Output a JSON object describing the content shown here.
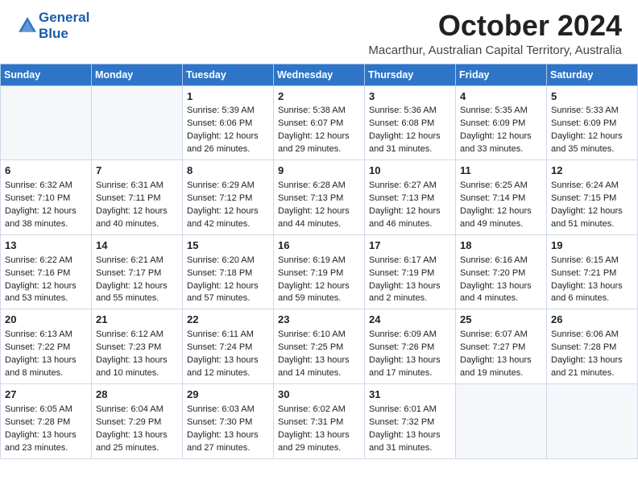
{
  "header": {
    "logo_line1": "General",
    "logo_line2": "Blue",
    "month_title": "October 2024",
    "location": "Macarthur, Australian Capital Territory, Australia"
  },
  "weekdays": [
    "Sunday",
    "Monday",
    "Tuesday",
    "Wednesday",
    "Thursday",
    "Friday",
    "Saturday"
  ],
  "weeks": [
    [
      {
        "day": "",
        "info": ""
      },
      {
        "day": "",
        "info": ""
      },
      {
        "day": "1",
        "info": "Sunrise: 5:39 AM\nSunset: 6:06 PM\nDaylight: 12 hours\nand 26 minutes."
      },
      {
        "day": "2",
        "info": "Sunrise: 5:38 AM\nSunset: 6:07 PM\nDaylight: 12 hours\nand 29 minutes."
      },
      {
        "day": "3",
        "info": "Sunrise: 5:36 AM\nSunset: 6:08 PM\nDaylight: 12 hours\nand 31 minutes."
      },
      {
        "day": "4",
        "info": "Sunrise: 5:35 AM\nSunset: 6:09 PM\nDaylight: 12 hours\nand 33 minutes."
      },
      {
        "day": "5",
        "info": "Sunrise: 5:33 AM\nSunset: 6:09 PM\nDaylight: 12 hours\nand 35 minutes."
      }
    ],
    [
      {
        "day": "6",
        "info": "Sunrise: 6:32 AM\nSunset: 7:10 PM\nDaylight: 12 hours\nand 38 minutes."
      },
      {
        "day": "7",
        "info": "Sunrise: 6:31 AM\nSunset: 7:11 PM\nDaylight: 12 hours\nand 40 minutes."
      },
      {
        "day": "8",
        "info": "Sunrise: 6:29 AM\nSunset: 7:12 PM\nDaylight: 12 hours\nand 42 minutes."
      },
      {
        "day": "9",
        "info": "Sunrise: 6:28 AM\nSunset: 7:13 PM\nDaylight: 12 hours\nand 44 minutes."
      },
      {
        "day": "10",
        "info": "Sunrise: 6:27 AM\nSunset: 7:13 PM\nDaylight: 12 hours\nand 46 minutes."
      },
      {
        "day": "11",
        "info": "Sunrise: 6:25 AM\nSunset: 7:14 PM\nDaylight: 12 hours\nand 49 minutes."
      },
      {
        "day": "12",
        "info": "Sunrise: 6:24 AM\nSunset: 7:15 PM\nDaylight: 12 hours\nand 51 minutes."
      }
    ],
    [
      {
        "day": "13",
        "info": "Sunrise: 6:22 AM\nSunset: 7:16 PM\nDaylight: 12 hours\nand 53 minutes."
      },
      {
        "day": "14",
        "info": "Sunrise: 6:21 AM\nSunset: 7:17 PM\nDaylight: 12 hours\nand 55 minutes."
      },
      {
        "day": "15",
        "info": "Sunrise: 6:20 AM\nSunset: 7:18 PM\nDaylight: 12 hours\nand 57 minutes."
      },
      {
        "day": "16",
        "info": "Sunrise: 6:19 AM\nSunset: 7:19 PM\nDaylight: 12 hours\nand 59 minutes."
      },
      {
        "day": "17",
        "info": "Sunrise: 6:17 AM\nSunset: 7:19 PM\nDaylight: 13 hours\nand 2 minutes."
      },
      {
        "day": "18",
        "info": "Sunrise: 6:16 AM\nSunset: 7:20 PM\nDaylight: 13 hours\nand 4 minutes."
      },
      {
        "day": "19",
        "info": "Sunrise: 6:15 AM\nSunset: 7:21 PM\nDaylight: 13 hours\nand 6 minutes."
      }
    ],
    [
      {
        "day": "20",
        "info": "Sunrise: 6:13 AM\nSunset: 7:22 PM\nDaylight: 13 hours\nand 8 minutes."
      },
      {
        "day": "21",
        "info": "Sunrise: 6:12 AM\nSunset: 7:23 PM\nDaylight: 13 hours\nand 10 minutes."
      },
      {
        "day": "22",
        "info": "Sunrise: 6:11 AM\nSunset: 7:24 PM\nDaylight: 13 hours\nand 12 minutes."
      },
      {
        "day": "23",
        "info": "Sunrise: 6:10 AM\nSunset: 7:25 PM\nDaylight: 13 hours\nand 14 minutes."
      },
      {
        "day": "24",
        "info": "Sunrise: 6:09 AM\nSunset: 7:26 PM\nDaylight: 13 hours\nand 17 minutes."
      },
      {
        "day": "25",
        "info": "Sunrise: 6:07 AM\nSunset: 7:27 PM\nDaylight: 13 hours\nand 19 minutes."
      },
      {
        "day": "26",
        "info": "Sunrise: 6:06 AM\nSunset: 7:28 PM\nDaylight: 13 hours\nand 21 minutes."
      }
    ],
    [
      {
        "day": "27",
        "info": "Sunrise: 6:05 AM\nSunset: 7:28 PM\nDaylight: 13 hours\nand 23 minutes."
      },
      {
        "day": "28",
        "info": "Sunrise: 6:04 AM\nSunset: 7:29 PM\nDaylight: 13 hours\nand 25 minutes."
      },
      {
        "day": "29",
        "info": "Sunrise: 6:03 AM\nSunset: 7:30 PM\nDaylight: 13 hours\nand 27 minutes."
      },
      {
        "day": "30",
        "info": "Sunrise: 6:02 AM\nSunset: 7:31 PM\nDaylight: 13 hours\nand 29 minutes."
      },
      {
        "day": "31",
        "info": "Sunrise: 6:01 AM\nSunset: 7:32 PM\nDaylight: 13 hours\nand 31 minutes."
      },
      {
        "day": "",
        "info": ""
      },
      {
        "day": "",
        "info": ""
      }
    ]
  ]
}
